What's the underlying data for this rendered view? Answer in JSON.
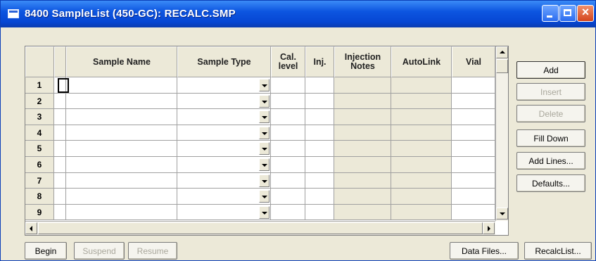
{
  "window": {
    "title": "8400 SampleList (450-GC): RECALC.SMP"
  },
  "grid": {
    "columns": [
      "Sample Name",
      "Sample Type",
      "Cal.\nlevel",
      "Inj.",
      "Injection\nNotes",
      "AutoLink",
      "Vial"
    ],
    "rows": [
      "1",
      "2",
      "3",
      "4",
      "5",
      "6",
      "7",
      "8",
      "9"
    ]
  },
  "side_buttons": {
    "add": "Add",
    "insert": "Insert",
    "delete": "Delete",
    "fill_down": "Fill Down",
    "add_lines": "Add Lines...",
    "defaults": "Defaults..."
  },
  "bottom_buttons": {
    "begin": "Begin",
    "suspend": "Suspend",
    "resume": "Resume",
    "data_files": "Data Files...",
    "recalc_list": "RecalcList..."
  },
  "colors": {
    "title_bar": "#0646d3",
    "face": "#ece9d8"
  },
  "icons": [
    "app-icon",
    "minimize-icon",
    "maximize-icon",
    "close-icon",
    "dropdown-arrow-icon",
    "scroll-up-icon",
    "scroll-down-icon",
    "scroll-left-icon",
    "scroll-right-icon"
  ]
}
